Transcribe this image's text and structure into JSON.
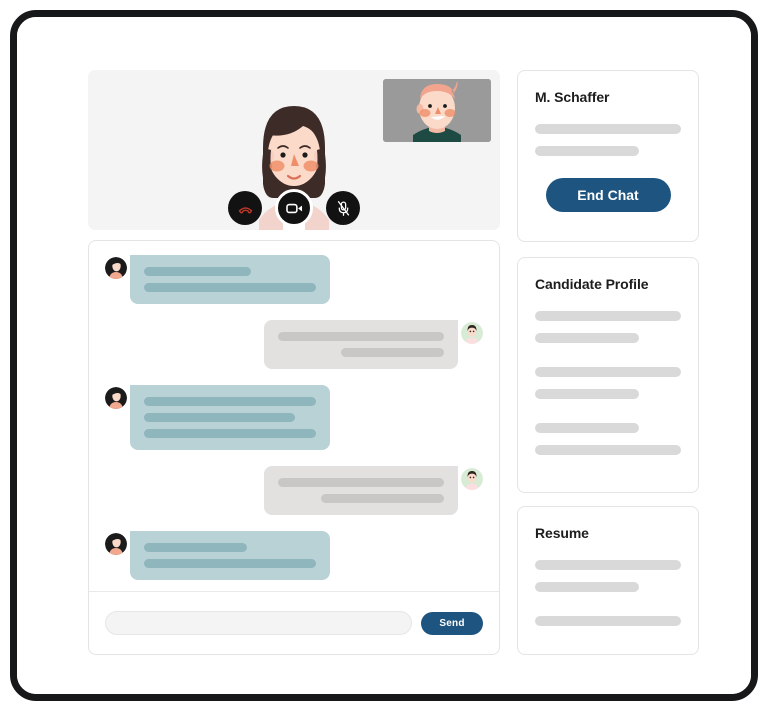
{
  "video_call": {
    "panel_name": "video-call-panel",
    "remote_participant": "woman-illustration",
    "self_view_label": "self-view-thumbnail",
    "self_view_participant": "man-illustration",
    "controls": [
      {
        "id": "hang-up",
        "icon": "phone-hangup-icon",
        "label": "End call",
        "state": "active",
        "color": "#c0392b"
      },
      {
        "id": "camera",
        "icon": "video-camera-icon",
        "label": "Camera",
        "state": "on",
        "color": "#ffffff"
      },
      {
        "id": "microphone",
        "icon": "microphone-muted-icon",
        "label": "Microphone",
        "state": "muted",
        "color": "#ffffff"
      }
    ]
  },
  "chat": {
    "panel_name": "chat-panel",
    "messages": [
      {
        "side": "left",
        "avatar": "avatar-candidate",
        "lines": [
          62,
          100
        ]
      },
      {
        "side": "right",
        "avatar": "avatar-recruiter",
        "lines": [
          100,
          62
        ]
      },
      {
        "side": "left",
        "avatar": "avatar-candidate",
        "lines": [
          100,
          88,
          100
        ]
      },
      {
        "side": "right",
        "avatar": "avatar-recruiter",
        "lines": [
          100,
          74
        ]
      },
      {
        "side": "left",
        "avatar": "avatar-candidate",
        "lines": [
          60,
          100
        ]
      }
    ],
    "composer": {
      "input_value": "",
      "input_placeholder": "",
      "send_label": "Send"
    }
  },
  "sidebar": {
    "contact_card": {
      "title": "M. Schaffer",
      "skeleton_lines": [
        "full",
        "short"
      ],
      "end_chat_label": "End Chat"
    },
    "profile_card": {
      "title": "Candidate Profile",
      "skeleton_lines": [
        "full",
        "short",
        "full",
        "short",
        "short",
        "full"
      ]
    },
    "resume_card": {
      "title": "Resume",
      "skeleton_lines": [
        "full",
        "short",
        "full"
      ]
    }
  },
  "colors": {
    "accent_blue": "#1d5580",
    "bubble_incoming": "#b9d2d6",
    "bubble_outgoing": "#e3e1df",
    "skeleton_gray": "#d9d9d9",
    "panel_bg": "#f4f4f4",
    "frame": "#17181a"
  }
}
